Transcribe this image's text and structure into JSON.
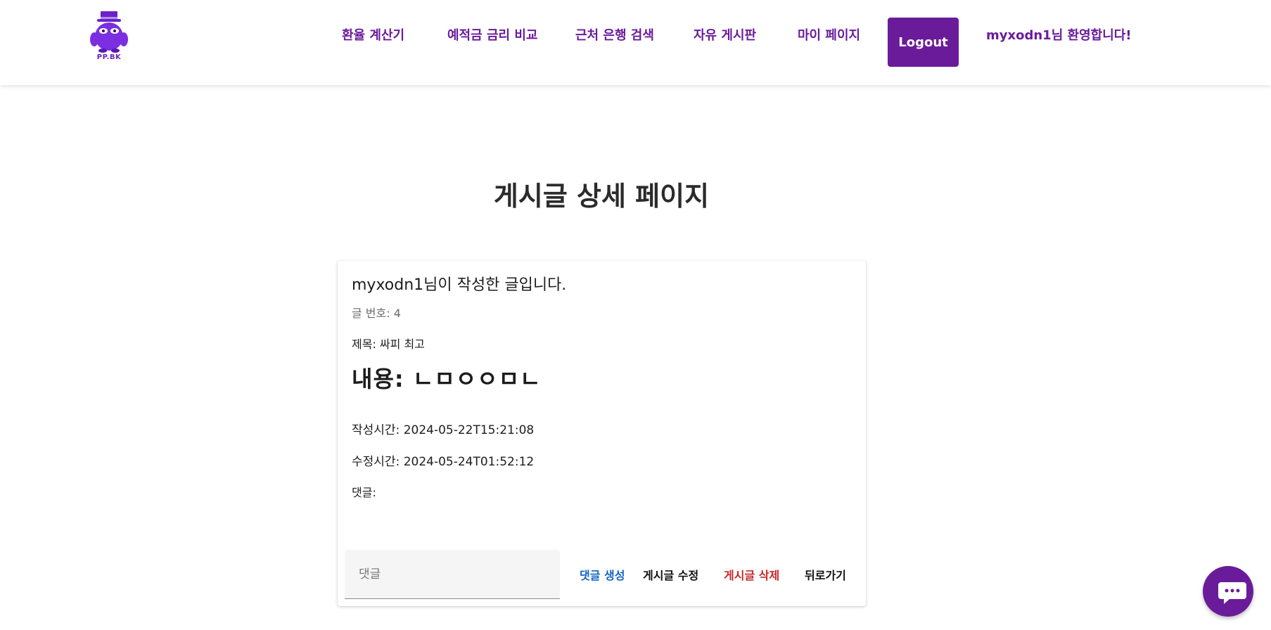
{
  "header": {
    "logo_text": "PP.BK",
    "nav": [
      {
        "label": "환율 계산기"
      },
      {
        "label": "예적금 금리 비교"
      },
      {
        "label": "근처 은행 검색"
      },
      {
        "label": "자유 게시판"
      },
      {
        "label": "마이 페이지"
      }
    ],
    "logout_label": "Logout",
    "welcome": "myxodn1님 환영합니다!",
    "brand_color": "#6a1b9a"
  },
  "page": {
    "title": "게시글 상세 페이지"
  },
  "post": {
    "author_line": "myxodn1님이 작성한 글입니다.",
    "number_line": "글 번호: 4",
    "title_line": "제목: 싸피 최고",
    "content_line": "내용: ㄴㅁㅇㅇㅁㄴ",
    "created_line": "작성시간: 2024-05-22T15:21:08",
    "updated_line": "수정시간: 2024-05-24T01:52:12",
    "comments_label": "댓글:"
  },
  "actions": {
    "comment_placeholder": "댓글",
    "create_comment": "댓글 생성",
    "edit_post": "게시글 수정",
    "delete_post": "게시글 삭제",
    "back": "뒤로가기",
    "create_color": "#1565c0",
    "delete_color": "#c62828"
  },
  "chat": {
    "icon": "chat-bubble-icon"
  }
}
